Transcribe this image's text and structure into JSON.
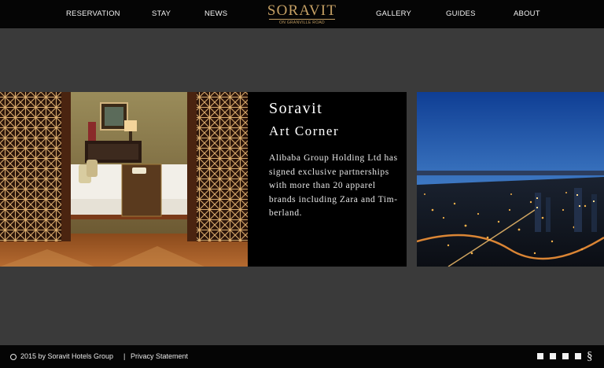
{
  "nav": {
    "reservation": "RESERVATION",
    "stay": "STAY",
    "news": "NEWS",
    "gallery": "GALLERY",
    "guides": "GUIDES",
    "about": "ABOUT"
  },
  "logo": {
    "name": "SORAVIT",
    "tagline": "ON GRANVILLE ROAD"
  },
  "feature": {
    "title": "Soravit",
    "subtitle": "Art Corner",
    "body": "Alibaba Group Holding Ltd has signed exclusive partnerships with more than 20 apparel brands including Zara and Tim-berland."
  },
  "footer": {
    "copyright": "2015 by Soravit Hotels Group",
    "separator": "|",
    "privacy": "Privacy Statement",
    "menu_icon": "§"
  },
  "colors": {
    "accent_gold": "#c5a064",
    "page_background": "#3a3a3a",
    "bar_background": "#050505"
  }
}
